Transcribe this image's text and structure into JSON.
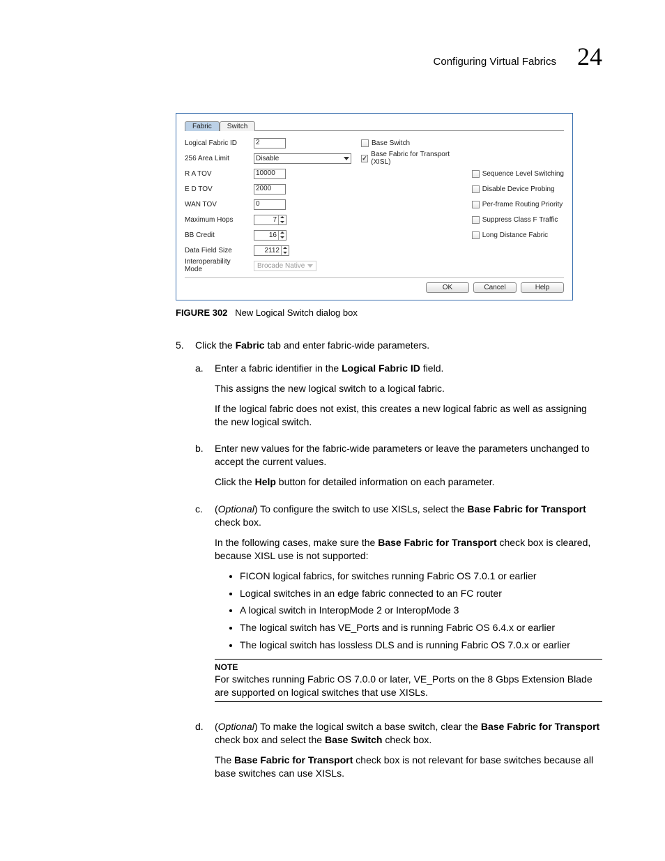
{
  "header": {
    "title": "Configuring Virtual Fabrics",
    "chapter": "24"
  },
  "dialog": {
    "tabs": {
      "active": "Fabric",
      "inactive": "Switch"
    },
    "labels": {
      "logical_fabric_id": "Logical Fabric ID",
      "area_limit": "256 Area Limit",
      "ra_tov": "R A TOV",
      "ed_tov": "E D TOV",
      "wan_tov": "WAN TOV",
      "max_hops": "Maximum Hops",
      "bb_credit": "BB Credit",
      "data_field_size": "Data Field Size",
      "interop_mode": "Interoperability Mode"
    },
    "values": {
      "logical_fabric_id": "2",
      "area_limit": "Disable",
      "ra_tov": "10000",
      "ed_tov": "2000",
      "wan_tov": "0",
      "max_hops": "7",
      "bb_credit": "16",
      "data_field_size": "2112",
      "interop_mode": "Brocade Native"
    },
    "check_top": {
      "base_switch": "Base Switch",
      "base_fabric_transport": "Base Fabric for Transport (XISL)"
    },
    "check_right": {
      "seq_level_switching": "Sequence Level Switching",
      "disable_device_probing": "Disable Device Probing",
      "per_frame_routing": "Per-frame Routing Priority",
      "suppress_class_f": "Suppress Class F Traffic",
      "long_distance_fabric": "Long Distance Fabric"
    },
    "buttons": {
      "ok": "OK",
      "cancel": "Cancel",
      "help": "Help"
    }
  },
  "figure": {
    "label": "FIGURE 302",
    "caption": "New Logical Switch dialog box"
  },
  "body": {
    "step5_num": "5.",
    "step5_a": "Click the ",
    "step5_b": "Fabric",
    "step5_c": " tab and enter fabric-wide parameters.",
    "a_letter": "a.",
    "a1a": "Enter a fabric identifier in the ",
    "a1b": "Logical Fabric ID",
    "a1c": " field.",
    "a2": "This assigns the new logical switch to a logical fabric.",
    "a3": "If the logical fabric does not exist, this creates a new logical fabric as well as assigning the new logical switch.",
    "b_letter": "b.",
    "b1": "Enter new values for the fabric-wide parameters or leave the parameters unchanged to accept the current values.",
    "b2a": "Click the ",
    "b2b": "Help",
    "b2c": " button for detailed information on each parameter.",
    "c_letter": "c.",
    "c1a": "(",
    "c1b": "Optional",
    "c1c": ") To configure the switch to use XISLs, select the ",
    "c1d": "Base Fabric for Transport",
    "c1e": " check box.",
    "c2a": "In the following cases, make sure the ",
    "c2b": "Base Fabric for Transport",
    "c2c": " check box is cleared, because XISL use is not supported:",
    "bul1": "FICON logical fabrics, for switches running Fabric OS 7.0.1 or earlier",
    "bul2": "Logical switches in an edge fabric connected to an FC router",
    "bul3": "A logical switch in InteropMode 2 or InteropMode 3",
    "bul4": "The logical switch has VE_Ports and is running Fabric OS 6.4.x or earlier",
    "bul5": "The logical switch has lossless DLS and is running Fabric OS 7.0.x or earlier",
    "note_hdr": "NOTE",
    "note_text": "For switches running Fabric OS 7.0.0 or later, VE_Ports on the 8 Gbps Extension Blade are supported on logical switches that use XISLs.",
    "d_letter": "d.",
    "d1a": "(",
    "d1b": "Optional",
    "d1c": ") To make the logical switch a base switch, clear the ",
    "d1d": "Base Fabric for Transport",
    "d1e": " check box and select the ",
    "d1f": "Base Switch",
    "d1g": " check box.",
    "d2a": "The ",
    "d2b": "Base Fabric for Transport",
    "d2c": " check box is not relevant for base switches because all base switches can use XISLs."
  }
}
